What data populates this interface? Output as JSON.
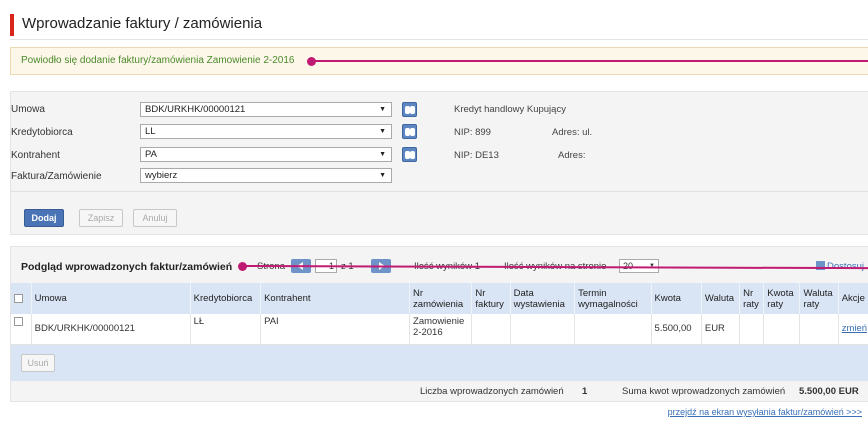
{
  "page": {
    "title": "Wprowadzanie faktury / zamówienia"
  },
  "alert": {
    "message": "Powiodło się dodanie faktury/zamówienia Zamowienie 2-2016"
  },
  "form": {
    "umowa": {
      "label": "Umowa",
      "value": "BDK/URKHK/00000121",
      "info": "Kredyt handlowy Kupujący"
    },
    "kredytobiorca": {
      "label": "Kredytobiorca",
      "value": "LL",
      "nip": "NIP: 899",
      "adres": "Adres: ul."
    },
    "kontrahent": {
      "label": "Kontrahent",
      "value": "PA",
      "nip": "NIP: DE13",
      "adres": "Adres:"
    },
    "faktura": {
      "label": "Faktura/Zamówienie",
      "value": "wybierz"
    },
    "buttons": {
      "dodaj": "Dodaj",
      "zapisz": "Zapisz",
      "anuluj": "Anuluj"
    }
  },
  "list": {
    "title": "Podgląd wprowadzonych faktur/zamówień",
    "pager": {
      "strona_label": "Strona",
      "page_value": "1",
      "of_label": "z 1",
      "results_label": "Ilość wyników 1",
      "per_page_label": "Ilość wyników na stronie",
      "per_page_value": "20"
    },
    "adjust_label": "Dostosuj",
    "columns": [
      "Umowa",
      "Kredytobiorca",
      "Kontrahent",
      "Nr zamówienia",
      "Nr faktury",
      "Data wystawienia",
      "Termin wymagalności",
      "Kwota",
      "Waluta",
      "Nr raty",
      "Kwota raty",
      "Waluta raty",
      "Akcje"
    ],
    "rows": [
      {
        "umowa": "BDK/URKHK/00000121",
        "kredytobiorca": "LŁ",
        "kontrahent": "PAI",
        "nr_zamowienia": "Zamowienie 2-2016",
        "nr_faktury": "",
        "data": "",
        "termin": "",
        "kwota": "5.500,00",
        "waluta": "EUR",
        "nr_raty": "",
        "kwota_raty": "",
        "waluta_raty": "",
        "akcje": "zmień"
      }
    ],
    "usun_label": "Usuń",
    "summary": {
      "count_label": "Liczba wprowadzonych zamówień",
      "count_value": "1",
      "sum_label": "Suma kwot wprowadzonych zamówień",
      "sum_value": "5.500,00 EUR"
    }
  },
  "footer": {
    "link": "przejdź na ekran wysyłania faktur/zamówień >>>"
  },
  "colors": {
    "accent_red": "#d9261c",
    "annotation": "#c01a72",
    "header_blue": "#d9e5f5",
    "button_blue": "#4a74b5"
  }
}
